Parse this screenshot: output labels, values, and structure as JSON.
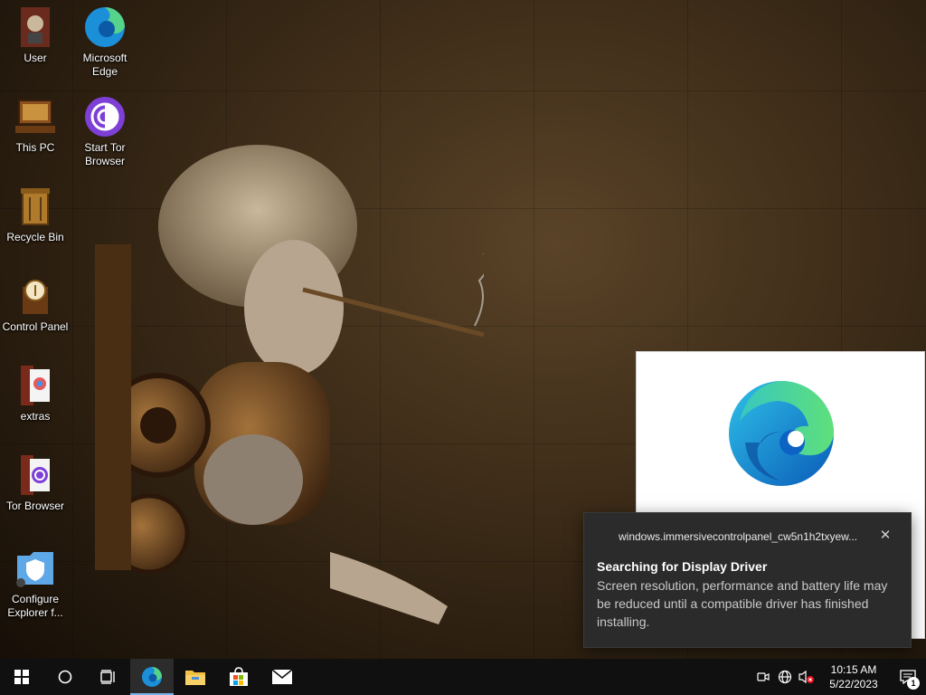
{
  "desktop": {
    "icons": [
      {
        "label": "User"
      },
      {
        "label": "Microsoft Edge"
      },
      {
        "label": "This PC"
      },
      {
        "label": "Start Tor Browser"
      },
      {
        "label": "Recycle Bin"
      },
      {
        "label": "Control Panel"
      },
      {
        "label": "extras"
      },
      {
        "label": "Tor Browser"
      },
      {
        "label": "Configure Explorer f..."
      }
    ]
  },
  "toast": {
    "app_name": "windows.immersivecontrolpanel_cw5n1h2txyew...",
    "close_glyph": "✕",
    "title": "Searching for Display Driver",
    "body": "Screen resolution, performance and battery life may be reduced until a compatible driver has finished installing."
  },
  "taskbar": {
    "items": [
      "start-icon",
      "search-icon",
      "task-view-icon",
      "edge-icon",
      "file-explorer-icon",
      "store-icon",
      "mail-icon"
    ],
    "active_item": "edge-icon",
    "clock": {
      "time": "10:15 AM",
      "date": "5/22/2023"
    },
    "notification_count": "1"
  },
  "colors": {
    "taskbar": "#101010",
    "toast_bg": "#2b2b2b",
    "active_indicator": "#77b3e8"
  }
}
